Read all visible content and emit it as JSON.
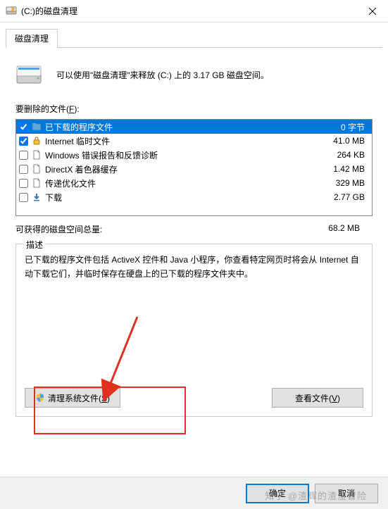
{
  "window": {
    "title": "(C:)的磁盘清理"
  },
  "tab": {
    "label": "磁盘清理"
  },
  "intro": {
    "text": "可以使用\"磁盘清理\"来释放  (C:) 上的 3.17 GB 磁盘空间。"
  },
  "delete_label": "要删除的文件(",
  "delete_label_u": "F",
  "delete_label_end": "):",
  "files": [
    {
      "checked": true,
      "name": "已下载的程序文件",
      "size": "0 字节",
      "icon": "folder-blue"
    },
    {
      "checked": true,
      "name": "Internet 临时文件",
      "size": "41.0 MB",
      "icon": "lock"
    },
    {
      "checked": false,
      "name": "Windows 错误报告和反馈诊断",
      "size": "264 KB",
      "icon": "file"
    },
    {
      "checked": false,
      "name": "DirectX 着色器缓存",
      "size": "1.42 MB",
      "icon": "file"
    },
    {
      "checked": false,
      "name": "传递优化文件",
      "size": "329 MB",
      "icon": "file"
    },
    {
      "checked": false,
      "name": "下载",
      "size": "2.77 GB",
      "icon": "download"
    }
  ],
  "total": {
    "label": "可获得的磁盘空间总量:",
    "value": "68.2 MB"
  },
  "desc": {
    "legend": "描述",
    "text": "已下载的程序文件包括 ActiveX 控件和 Java 小程序，你查看特定网页时将会从 Internet 自动下载它们，并临时保存在硬盘上的已下载的程序文件夹中。"
  },
  "buttons": {
    "clean_system": "清理系统文件(",
    "clean_system_u": "S",
    "clean_system_end": ")",
    "view_files": "查看文件(",
    "view_files_u": "V",
    "view_files_end": ")",
    "ok": "确定",
    "cancel": "取消"
  },
  "watermark": "知乎 @渣辉的渣渣冒险"
}
